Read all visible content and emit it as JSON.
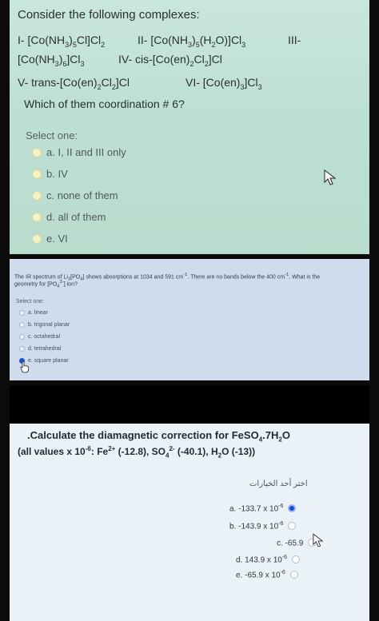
{
  "panel1": {
    "question_title": "Consider the following complexes:",
    "line1": {
      "i": "I- [Co(NH",
      "i_sub1": "3",
      "i_b": ")",
      "i_sub2": "5",
      "i_c": "Cl]Cl",
      "i_sub3": "2",
      "ii": "II- [Co(NH",
      "ii_sub1": "3",
      "ii_b": ")",
      "ii_sub2": "5",
      "ii_c": "(H",
      "ii_sub3": "2",
      "ii_d": "O)]Cl",
      "ii_sub4": "3",
      "iii": "III-"
    },
    "line2": {
      "a": "[Co(NH",
      "sub1": "3",
      "b": ")",
      "sub2": "6",
      "c": "]Cl",
      "sub3": "3",
      "iv": "IV- cis-[Co(en)",
      "iv_sub1": "2",
      "iv_b": "Cl",
      "iv_sub2": "2",
      "iv_c": "]Cl"
    },
    "line3": {
      "v": "V- trans-[Co(en)",
      "v_sub1": "2",
      "v_b": "Cl",
      "v_sub2": "2",
      "v_c": "]Cl",
      "vi": "VI- [Co(en)",
      "vi_sub1": "3",
      "vi_b": "]Cl",
      "vi_sub2": "3"
    },
    "question": "Which of them coordination # 6?",
    "select_one": "Select one:",
    "options": [
      "a. I, II and III only",
      "b. IV",
      "c. none of them",
      "d. all of them",
      "e. VI"
    ]
  },
  "panel2": {
    "question_line1_a": "The IR spectrum of Li",
    "question_line1_sub": "3",
    "question_line1_b": "[PO",
    "question_line1_sub2": "4",
    "question_line1_c": "] shows absorptions at 1034 and 591 cm",
    "question_line1_sup": "-1",
    "question_line1_d": ". There are no bands below the 400 cm",
    "question_line1_sup2": "-1",
    "question_line1_e": ". What is the",
    "question_line2_a": "geometry for [PO",
    "question_line2_sub": "4",
    "question_line2_sup": "3-",
    "question_line2_b": "] ion?",
    "select_one": "Select one:",
    "options": [
      "a. linear",
      "b. trigonal planar",
      "c. octahedral",
      "d. tetrahedral",
      "e. square planar"
    ],
    "selected_index": 4
  },
  "panel3": {
    "title_a": ".Calculate the diamagnetic correction for FeSO",
    "title_sub1": "4",
    "title_b": ".7H",
    "title_sub2": "2",
    "title_c": "O",
    "line2_a": "(all values x 10",
    "line2_sup1": "-6",
    "line2_b": ": Fe",
    "line2_sup2": "2+",
    "line2_c": " (-12.8), SO",
    "line2_sub": "4",
    "line2_sup3": "2-",
    "line2_d": " (-40.1), H",
    "line2_sub2": "2",
    "line2_e": "O (-13))",
    "arabic_label": "اختر أحد الخيارات",
    "options": [
      {
        "text": "a. -133.7 x 10",
        "sup": "-6"
      },
      {
        "text": "b. -143.9 x 10",
        "sup": "-6"
      },
      {
        "text": "c. -65.9",
        "sup": ""
      },
      {
        "text": "d. 143.9 x 10",
        "sup": "-6"
      },
      {
        "text": "e. -65.9 x 10",
        "sup": "-6"
      }
    ],
    "selected_index": 0
  },
  "colors": {
    "selected_radio": "#1f4fd6",
    "radio_fill": "#f5f2c4"
  }
}
